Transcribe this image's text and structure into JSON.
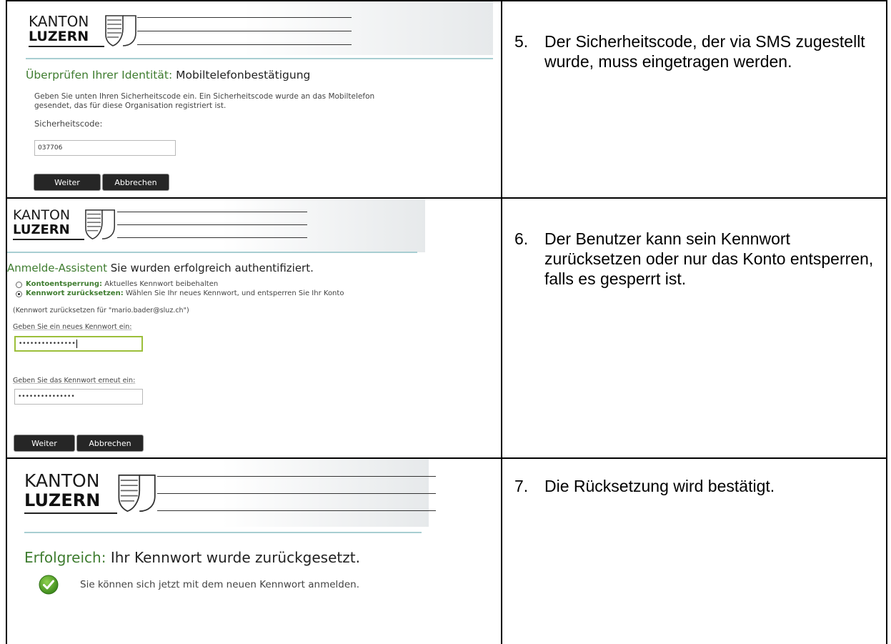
{
  "logo": {
    "kanton": "KANTON",
    "luzern": "LUZERN"
  },
  "row1": {
    "title_label": "Überprüfen Ihrer Identität:",
    "title_value": "Mobiltelefonbestätigung",
    "info_line1": "Geben Sie unten Ihren Sicherheitscode ein. Ein Sicherheitscode wurde an das Mobiltelefon",
    "info_line2": "gesendet, das für diese Organisation registriert ist.",
    "code_label": "Sicherheitscode:",
    "code_value": "037706",
    "next_label": "Weiter",
    "cancel_label": "Abbrechen",
    "step_number": "5.",
    "description": "Der Sicherheitscode, der via SMS zugestellt wurde, muss eingetragen werden."
  },
  "row2": {
    "title_label": "Anmelde-Assistent",
    "title_value": "Sie wurden erfolgreich authentifiziert.",
    "option1_bold": "Kontoentsperrung:",
    "option1_text": "Aktuelles Kennwort beibehalten",
    "option2_bold": "Kennwort zurücksetzen:",
    "option2_text": "Wählen Sie Ihr neues Kennwort, und entsperren Sie Ihr Konto",
    "reset_note": "(Kennwort zurücksetzen für \"mario.bader@sluz.ch\")",
    "new_pw_label": "Geben Sie ein neues Kennwort ein:",
    "new_pw_value": "•••••••••••••••",
    "confirm_pw_label": "Geben Sie das Kennwort erneut ein:",
    "confirm_pw_value": "•••••••••••••••",
    "next_label": "Weiter",
    "cancel_label": "Abbrechen",
    "selected_option": 2,
    "step_number": "6.",
    "description": "Der Benutzer kann sein Kennwort zurücksetzen oder nur das Konto entsperren, falls es gesperrt ist."
  },
  "row3": {
    "title_label": "Erfolgreich:",
    "title_value": "Ihr Kennwort wurde zurückgesetzt.",
    "success_icon": "check-circle-icon",
    "message": "Sie können sich jetzt mit dem neuen Kennwort anmelden.",
    "step_number": "7.",
    "description": "Die Rücksetzung wird bestätigt."
  },
  "colors": {
    "accent_green": "#3e7c2f",
    "success_green": "#5aa02c",
    "button_dark": "#262626",
    "focus_border": "#9cbf3a"
  }
}
